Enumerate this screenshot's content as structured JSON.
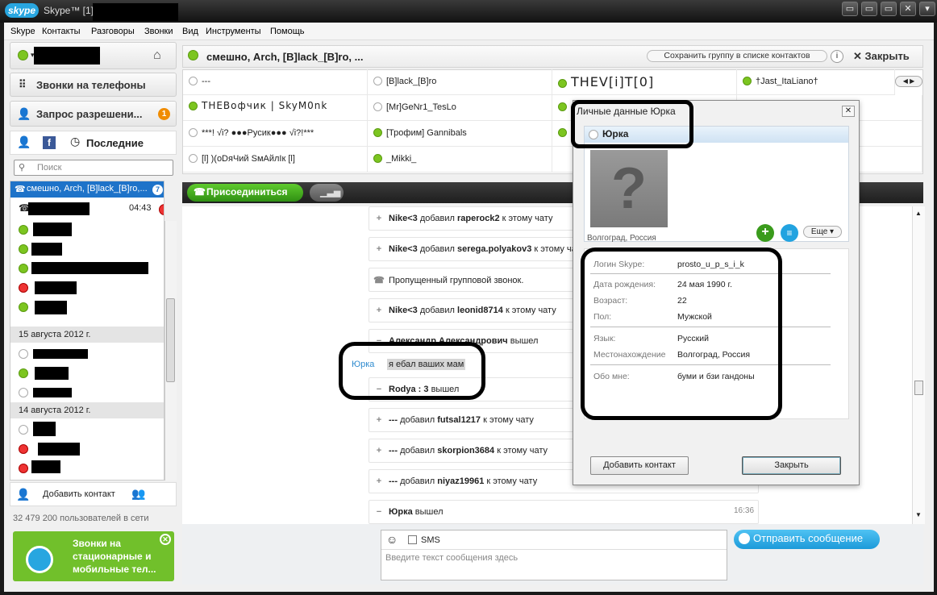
{
  "window": {
    "app_name": "Skype™ [1] -",
    "logo": "skype",
    "controls": [
      "minimize",
      "maximize",
      "close"
    ]
  },
  "menu": [
    "Skype",
    "Контакты",
    "Разговоры",
    "Звонки",
    "Вид",
    "Инструменты",
    "Помощь"
  ],
  "sidebar": {
    "call_phones": "Звонки на телефоны",
    "auth_request": "Запрос разрешени...",
    "auth_badge": "1",
    "recent_tab": "Последние",
    "search_placeholder": "Поиск",
    "active_conversation": "смешно, Arch, [B]lack_[B]ro,...",
    "active_badge": "7",
    "call_time": "04:43",
    "date1": "15 августа 2012 г.",
    "date2": "14 августа 2012 г.",
    "add_contact": "Добавить контакт",
    "online_count": "32 479 200 пользователей в сети",
    "promo_text": "Звонки на стационарные и мобильные тел..."
  },
  "conversation": {
    "title": "смешно, Arch, [B]lack_[B]ro, ...",
    "save_group": "Сохранить группу в списке контактов",
    "close": "Закрыть",
    "participants": [
      "---",
      "[B]lack_[B]ro",
      "THEV[i]T[0]",
      "†Jast_ItaLiano†",
      "THEВофчик | SkyM0nk",
      "[Mr]GeNr1_TesLo",
      "",
      "",
      "***! √i? ●●●Русик●●● √i?!***",
      "[Трофим] Gannibals",
      "",
      "",
      "[l] )(оDяЧий SмАйлIк [l]",
      "_Mikki_",
      "",
      ""
    ],
    "join_button": "Присоединиться",
    "events": [
      {
        "icon": "+",
        "actor": "Nike<3",
        "verb": "добавил",
        "target": "raperock2",
        "suffix": "к этому чату"
      },
      {
        "icon": "+",
        "actor": "Nike<3",
        "verb": "добавил",
        "target": "serega.polyakov3",
        "suffix": "к этому чату"
      },
      {
        "icon": "☎",
        "actor": "",
        "verb": "Пропущенный групповой звонок.",
        "target": "",
        "suffix": ""
      },
      {
        "icon": "+",
        "actor": "Nike<3",
        "verb": "добавил",
        "target": "leonid8714",
        "suffix": "к этому чату"
      },
      {
        "icon": "−",
        "actor": "Александр Александрович",
        "verb": "вышел",
        "target": "",
        "suffix": ""
      },
      {
        "icon": "−",
        "actor": "Rodya : 3",
        "verb": "вышел",
        "target": "",
        "suffix": ""
      },
      {
        "icon": "+",
        "actor": "---",
        "verb": "добавил",
        "target": "futsal1217",
        "suffix": "к этому чату"
      },
      {
        "icon": "+",
        "actor": "---",
        "verb": "добавил",
        "target": "skorpion3684",
        "suffix": "к этому чату"
      },
      {
        "icon": "+",
        "actor": "---",
        "verb": "добавил",
        "target": "niyaz19961",
        "suffix": "к этому чату"
      },
      {
        "icon": "−",
        "actor": "Юрка",
        "verb": "вышел",
        "target": "",
        "suffix": ""
      }
    ],
    "message": {
      "sender": "Юрка",
      "text": "я ебал ваших мам"
    },
    "last_time": "16:36",
    "sms_label": "SMS",
    "composer_placeholder": "Введите текст сообщения здесь",
    "send_button": "Отправить сообщение"
  },
  "profile_dialog": {
    "title": "Личные данные Юрка",
    "name": "Юрка",
    "location": "Волгоград, Россия",
    "more": "Еще",
    "fields": [
      {
        "key": "Логин Skype:",
        "value": "prosto_u_p_s_i_k"
      },
      {
        "key": "Дата рождения:",
        "value": "24 мая 1990 г."
      },
      {
        "key": "Возраст:",
        "value": "22"
      },
      {
        "key": "Пол:",
        "value": "Мужской"
      },
      {
        "key": "Язык:",
        "value": "Русский"
      },
      {
        "key": "Местонахождение",
        "value": "Волгоград, Россия"
      },
      {
        "key": "Обо мне:",
        "value": "буми и бзи гандоны"
      }
    ],
    "add_contact_button": "Добавить контакт",
    "close_button": "Закрыть"
  },
  "colors": {
    "skype_blue": "#28a6e0",
    "online_green": "#7cc520",
    "join_green": "#3fa81c",
    "send_blue": "#22a3e0"
  }
}
